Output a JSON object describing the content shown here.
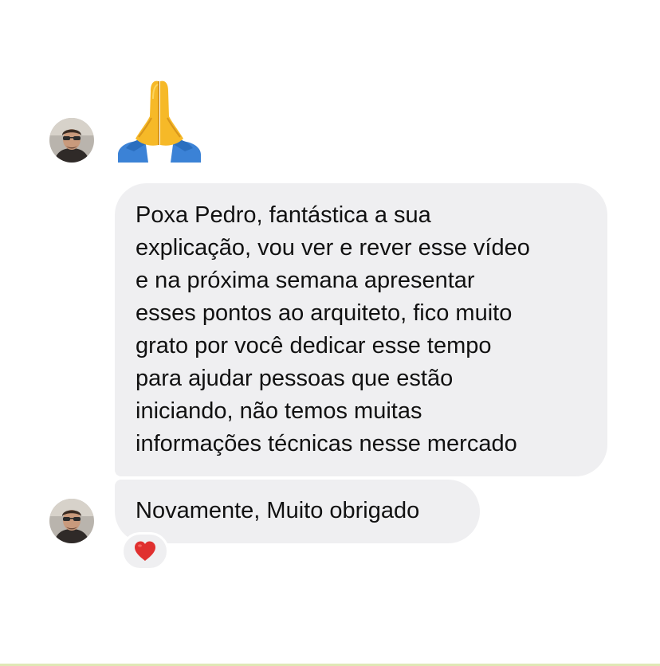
{
  "chat": {
    "messages": [
      {
        "type": "emoji",
        "icon": "folded-hands-icon"
      },
      {
        "type": "text",
        "lines": [
          "Poxa Pedro, fantástica a sua",
          "explicação, vou ver e rever esse vídeo",
          "e na próxima semana apresentar",
          "esses pontos ao arquiteto, fico muito",
          "grato por você dedicar esse tempo",
          "para ajudar pessoas que estão",
          "iniciando, não temos muitas",
          "informações técnicas nesse mercado"
        ]
      },
      {
        "type": "text",
        "text": "Novamente, Muito obrigado",
        "reaction": "heart-icon"
      }
    ]
  },
  "colors": {
    "bubble": "#efeff1",
    "text": "#111111",
    "heart": "#e0302f"
  }
}
